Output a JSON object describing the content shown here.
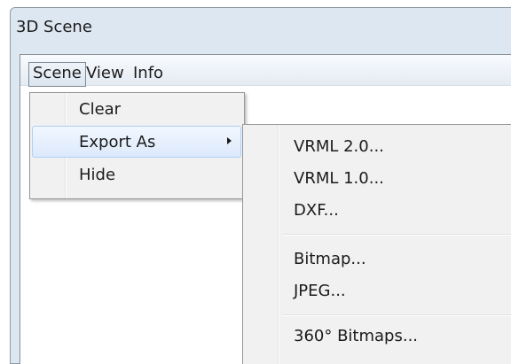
{
  "window": {
    "title": "3D Scene"
  },
  "menubar": {
    "items": [
      {
        "label": "Scene"
      },
      {
        "label": "View"
      },
      {
        "label": "Info"
      }
    ]
  },
  "scene_menu": {
    "items": [
      {
        "label": "Clear"
      },
      {
        "label": "Export As"
      },
      {
        "label": "Hide"
      }
    ]
  },
  "export_submenu": {
    "items": [
      {
        "label": "VRML 2.0..."
      },
      {
        "label": "VRML 1.0..."
      },
      {
        "label": "DXF..."
      },
      {
        "label": "Bitmap..."
      },
      {
        "label": "JPEG..."
      },
      {
        "label": "360° Bitmaps..."
      }
    ]
  }
}
